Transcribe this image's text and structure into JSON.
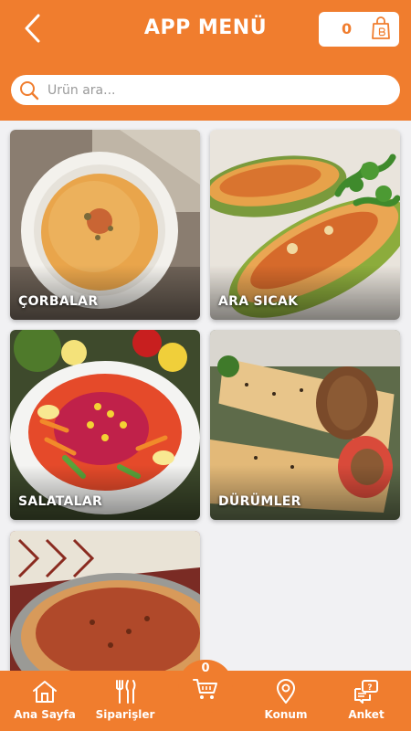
{
  "header": {
    "title": "APP MENÜ",
    "cart_count": "0",
    "back_icon": "chevron-left-icon",
    "cart_icon": "shopping-bag-icon"
  },
  "search": {
    "placeholder": "Ürün ara...",
    "value": "",
    "icon": "search-icon"
  },
  "categories": [
    {
      "label": "ÇORBALAR"
    },
    {
      "label": "ARA SICAK"
    },
    {
      "label": "SALATALAR"
    },
    {
      "label": "DÜRÜMLER"
    },
    {
      "label": ""
    }
  ],
  "bottom_nav": {
    "items": [
      {
        "label": "Ana Sayfa",
        "icon": "home-icon"
      },
      {
        "label": "Siparişler",
        "icon": "cutlery-icon"
      },
      {
        "label": "Konum",
        "icon": "location-pin-icon"
      },
      {
        "label": "Anket",
        "icon": "survey-chat-icon"
      }
    ],
    "cart_count": "0",
    "cart_icon": "shopping-cart-icon"
  },
  "colors": {
    "primary": "#f07d2e",
    "background": "#f1f1f3",
    "white": "#ffffff"
  }
}
